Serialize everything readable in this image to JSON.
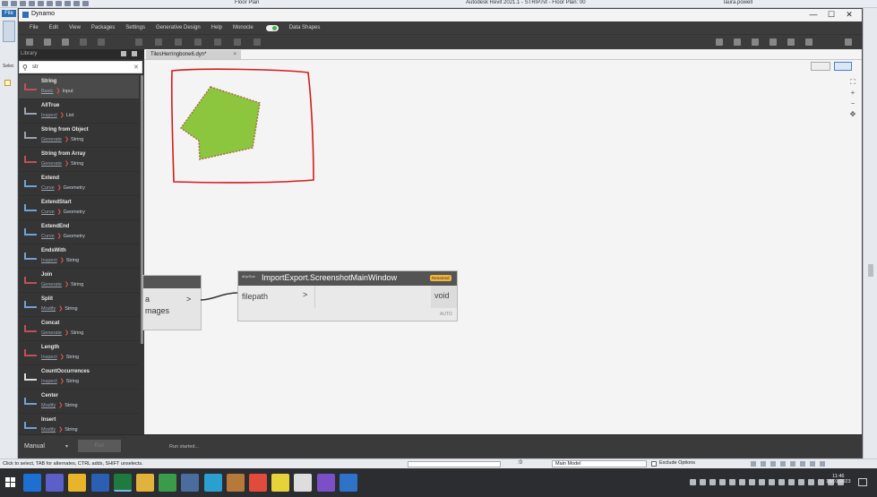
{
  "revit": {
    "doc_tab": "Floor Plan",
    "app_title": "Autodesk Revit 2021.1 - STRIP.rvt - Floor Plan: 00",
    "user": "laura.powell",
    "file_tab": "File",
    "left_label": "Selec",
    "status_hint": "Click to select, TAB for alternates, CTRL adds, SHIFT unselects.",
    "status_zero": ":0",
    "model": "Main Model",
    "exclude_options": "Exclude Options"
  },
  "dynamo": {
    "title": "Dynamo",
    "window_controls": {
      "minimize": "—",
      "maximize": "☐",
      "close": "✕"
    },
    "menu": [
      "File",
      "Edit",
      "View",
      "Packages",
      "Settings",
      "Generative Design",
      "Help",
      "Monocle"
    ],
    "data_shapes": "Data Shapes",
    "library": {
      "title": "Library",
      "search_value": "str",
      "items": [
        {
          "name": "String",
          "category": "Basic",
          "group": "Input",
          "icon_color": "#c14f5a"
        },
        {
          "name": "AllTrue",
          "category": "Inspect",
          "group": "List",
          "icon_color": "#9aa3b0"
        },
        {
          "name": "String from Object",
          "category": "Generate",
          "group": "String",
          "icon_color": "#9aa3b0"
        },
        {
          "name": "String from Array",
          "category": "Generate",
          "group": "String",
          "icon_color": "#c14f5a"
        },
        {
          "name": "Extend",
          "category": "Curve",
          "group": "Geometry",
          "icon_color": "#6fa3d6"
        },
        {
          "name": "ExtendStart",
          "category": "Curve",
          "group": "Geometry",
          "icon_color": "#6fa3d6"
        },
        {
          "name": "ExtendEnd",
          "category": "Curve",
          "group": "Geometry",
          "icon_color": "#6fa3d6"
        },
        {
          "name": "EndsWith",
          "category": "Inspect",
          "group": "String",
          "icon_color": "#6fa3d6"
        },
        {
          "name": "Join",
          "category": "Generate",
          "group": "String",
          "icon_color": "#c14f5a"
        },
        {
          "name": "Split",
          "category": "Modify",
          "group": "String",
          "icon_color": "#6fa3d6"
        },
        {
          "name": "Concat",
          "category": "Generate",
          "group": "String",
          "icon_color": "#c14f5a"
        },
        {
          "name": "Length",
          "category": "Inspect",
          "group": "String",
          "icon_color": "#c14f5a"
        },
        {
          "name": "CountOccurrences",
          "category": "Inspect",
          "group": "String",
          "icon_color": "#ddd"
        },
        {
          "name": "Center",
          "category": "Modify",
          "group": "String",
          "icon_color": "#6fa3d6"
        },
        {
          "name": "Insert",
          "category": "Modify",
          "group": "String",
          "icon_color": "#6fa3d6"
        }
      ]
    },
    "workspace_tab": "TilesHerringbone6.dyn*",
    "workspace_tab_close": "×",
    "zoom": {
      "fit": "⛶",
      "in": "+",
      "out": "−",
      "pan": "✥"
    },
    "node_left": {
      "line1": "a",
      "line2": "mages",
      "port": ">"
    },
    "node_main": {
      "package": "dhyrSon",
      "name": "ImportExport.ScreenshotMainWindow",
      "badge": "Renamed",
      "input": "filepath",
      "input_port": ">",
      "output": "void",
      "lacing": "AUTO"
    },
    "run": {
      "mode": "Manual",
      "dropdown": "▾",
      "button": "Run",
      "status": "Run started..."
    }
  },
  "taskbar": {
    "time": "11:46",
    "date": "18/01/2023",
    "apps": [
      {
        "name": "outlook",
        "color": "#1f6fd1"
      },
      {
        "name": "teams",
        "color": "#5b5fc7"
      },
      {
        "name": "chrome",
        "color": "#e8b52a"
      },
      {
        "name": "word",
        "color": "#2b5fb3"
      },
      {
        "name": "excel",
        "color": "#1e7a3e"
      },
      {
        "name": "explorer",
        "color": "#e2b33b"
      },
      {
        "name": "dynamo",
        "color": "#3a9b4a"
      },
      {
        "name": "revit-file",
        "color": "#4a6d9e"
      },
      {
        "name": "edge",
        "color": "#2a9fd0"
      },
      {
        "name": "dynamo-2",
        "color": "#b7793a"
      },
      {
        "name": "chrome-2",
        "color": "#e04b3b"
      },
      {
        "name": "sticky-notes",
        "color": "#e8d23a"
      },
      {
        "name": "inkscape",
        "color": "#ddd"
      },
      {
        "name": "visual-studio",
        "color": "#7a4fc7"
      },
      {
        "name": "revit",
        "color": "#2f73c9"
      }
    ]
  },
  "colors": {
    "annotation_red": "#d61b1b",
    "shape_fill": "#8cc63f",
    "badge": "#f3b43c"
  }
}
